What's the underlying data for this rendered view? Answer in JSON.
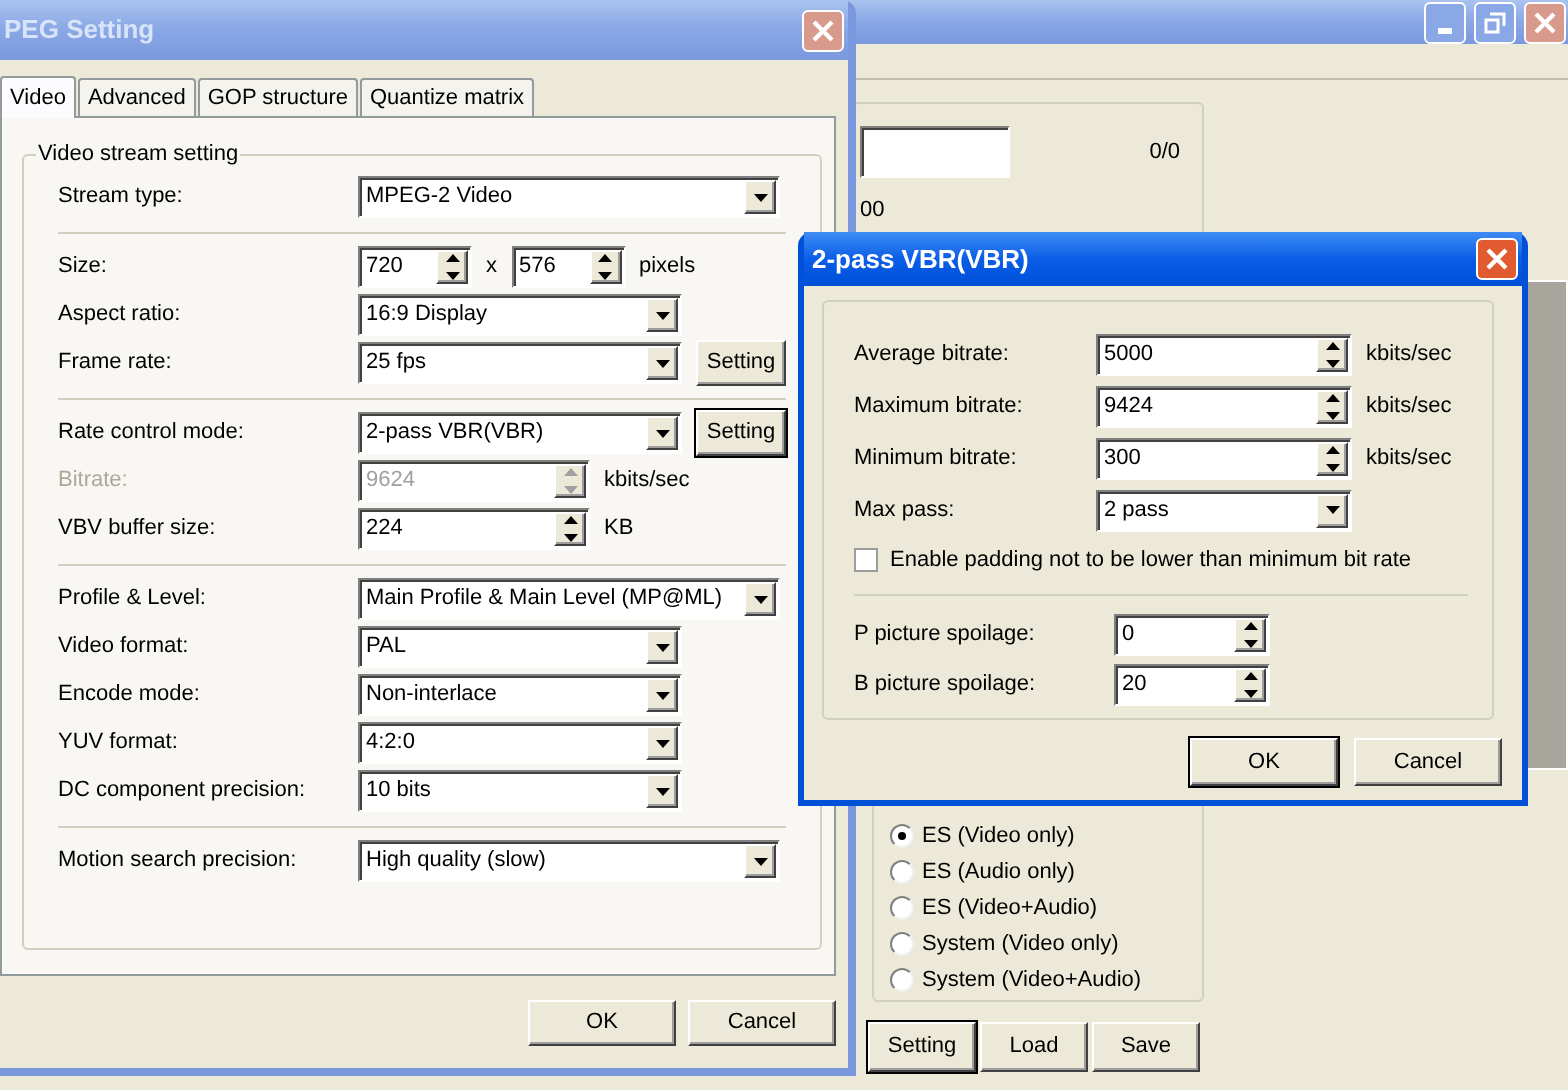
{
  "app_window": {
    "counter": "0/0",
    "partial_value": "00",
    "stream_type_options": [
      {
        "label": "ES (Video only)",
        "selected": true
      },
      {
        "label": "ES (Audio only)",
        "selected": false
      },
      {
        "label": "ES (Video+Audio)",
        "selected": false
      },
      {
        "label": "System (Video only)",
        "selected": false
      },
      {
        "label": "System (Video+Audio)",
        "selected": false
      }
    ],
    "buttons": [
      {
        "label": "Setting",
        "focused": true
      },
      {
        "label": "Load",
        "focused": false
      },
      {
        "label": "Save",
        "focused": false
      }
    ]
  },
  "mpeg_dialog": {
    "title": "PEG Setting",
    "active": false,
    "tabs": [
      {
        "label": "Video",
        "selected": true
      },
      {
        "label": "Advanced",
        "selected": false
      },
      {
        "label": "GOP structure",
        "selected": false
      },
      {
        "label": "Quantize matrix",
        "selected": false
      }
    ],
    "legend": "Video stream setting",
    "sections": [
      [
        {
          "label": "Stream type:",
          "kind": "combo",
          "value": "MPEG-2 Video",
          "disabled": false
        }
      ],
      [
        {
          "label": "Size:",
          "kind": "size",
          "value": "720",
          "separator": "x",
          "value2": "576",
          "unit": "pixels",
          "disabled": false
        },
        {
          "label": "Aspect ratio:",
          "kind": "dropdown",
          "value": "16:9 Display",
          "disabled": false
        },
        {
          "label": "Frame rate:",
          "kind": "dropdown",
          "value": "25 fps",
          "button": {
            "label": "Setting",
            "focused": false
          },
          "disabled": false
        }
      ],
      [
        {
          "label": "Rate control mode:",
          "kind": "dropdown",
          "value": "2-pass VBR(VBR)",
          "button": {
            "label": "Setting",
            "focused": true
          },
          "disabled": false
        },
        {
          "label": "Bitrate:",
          "kind": "spin",
          "value": "9624",
          "unit": "kbits/sec",
          "disabled": true
        },
        {
          "label": "VBV buffer size:",
          "kind": "spin",
          "value": "224",
          "unit": "KB",
          "disabled": false
        }
      ],
      [
        {
          "label": "Profile & Level:",
          "kind": "combo",
          "value": "Main Profile & Main Level (MP@ML)",
          "disabled": false
        },
        {
          "label": "Video format:",
          "kind": "dropdown",
          "value": "PAL",
          "disabled": false
        },
        {
          "label": "Encode mode:",
          "kind": "dropdown",
          "value": "Non-interlace",
          "disabled": false
        },
        {
          "label": "YUV format:",
          "kind": "dropdown",
          "value": "4:2:0",
          "disabled": false
        },
        {
          "label": "DC component precision:",
          "kind": "dropdown",
          "value": "10 bits",
          "disabled": false
        }
      ],
      [
        {
          "label": "Motion search precision:",
          "kind": "combo",
          "value": "High quality (slow)",
          "disabled": false
        }
      ]
    ],
    "buttons": [
      {
        "label": "OK",
        "focused": false
      },
      {
        "label": "Cancel",
        "focused": false
      }
    ]
  },
  "vbr_dialog": {
    "title": "2-pass VBR(VBR)",
    "active": true,
    "rows": [
      {
        "label": "Average bitrate:",
        "kind": "spin",
        "value": "5000",
        "unit": "kbits/sec"
      },
      {
        "label": "Maximum bitrate:",
        "kind": "spin",
        "value": "9424",
        "unit": "kbits/sec"
      },
      {
        "label": "Minimum bitrate:",
        "kind": "spin",
        "value": "300",
        "unit": "kbits/sec"
      },
      {
        "label": "Max pass:",
        "kind": "dropdown",
        "value": "2 pass"
      }
    ],
    "checkbox": {
      "label": "Enable padding not to be lower than minimum bit rate",
      "checked": false
    },
    "spoilage": [
      {
        "label": "P picture spoilage:",
        "value": "0"
      },
      {
        "label": "B picture spoilage:",
        "value": "20"
      }
    ],
    "buttons": [
      {
        "label": "OK",
        "focused": true
      },
      {
        "label": "Cancel",
        "focused": false
      }
    ]
  }
}
